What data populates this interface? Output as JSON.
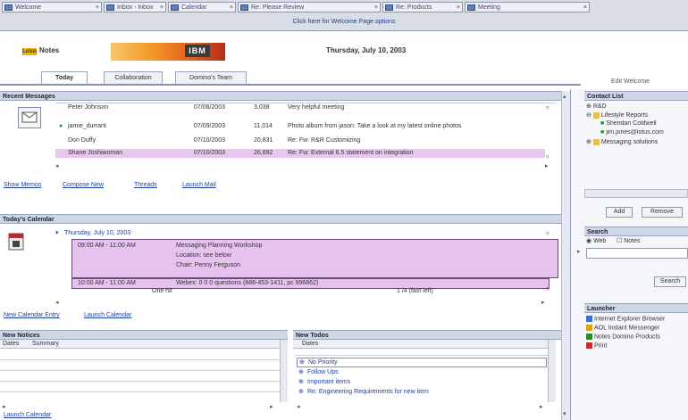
{
  "window_tabs": [
    {
      "label": "Welcome"
    },
    {
      "label": "Inbox - Inbox"
    },
    {
      "label": "Calendar"
    },
    {
      "label": "Re: Please Review"
    },
    {
      "label": "Re: Products"
    },
    {
      "label": "Meeting"
    }
  ],
  "welcome_bar": "Click here for Welcome Page options",
  "header": {
    "badge": "Lotus",
    "app_name": "Notes",
    "logo": "IBM",
    "date_title": "Thursday, July 10, 2003"
  },
  "nav_tabs": [
    "Today",
    "Collaboration",
    "Domino's Team"
  ],
  "edit_welcome": "Edit Welcome",
  "recent_messages": {
    "title": "Recent Messages",
    "rows": [
      {
        "from": "Peter Johnson",
        "date": "07/08/2003",
        "size": "3,038",
        "subject": "Very helpful meeting"
      },
      {
        "from": "jamie_durrant",
        "date": "07/09/2003",
        "size": "11,014",
        "subject": "Photo album from jason: Take a look at my latest online photos"
      },
      {
        "from": "Don Duffy",
        "date": "07/10/2003",
        "size": "20,831",
        "subject": "Re: Fw: R&R Customizing"
      },
      {
        "from": "Shane Joshiwoman",
        "date": "07/10/2003",
        "size": "26,892",
        "subject": "Re: Fw: External 6.5 statement on integration"
      }
    ],
    "links": [
      "Show Memos",
      "Compose New",
      "Threads",
      "Launch Mail"
    ]
  },
  "calendar": {
    "title": "Today's Calendar",
    "day_label": "Thursday, July 10, 2003",
    "entries": [
      {
        "time": "09:00 AM - 11:00 AM",
        "text": "Messaging Planning Workshop",
        "location": "Location: see below",
        "chair": "Chair: Penny Ferguson"
      },
      {
        "time": "10:00 AM - 11:00 AM",
        "text": "Webex: 0 0 0 questions (888-453-1411, pc 996862)"
      }
    ],
    "count_left": "One hit",
    "count_right": "1 /4 (fast left)",
    "links": [
      "New Calendar Entry",
      "Launch Calendar"
    ]
  },
  "new_notices": {
    "title": "New Notices",
    "columns": [
      "Dates",
      "Summary"
    ],
    "launch": "Launch Calendar"
  },
  "new_todos": {
    "title": "New Todos",
    "column": "Dates",
    "items": [
      "No Priority",
      "Follow Ups",
      "Important items",
      "Re: Engineering Requirements for new item"
    ]
  },
  "contact_list": {
    "title": "Contact List",
    "items": [
      "R&D",
      "Lifestyle Reports",
      "Sheridan Coldwell",
      "jim.jones@lotus.com",
      "Messaging solutions"
    ],
    "buttons": [
      "Add",
      "Remove"
    ]
  },
  "search": {
    "title": "Search",
    "options": [
      "Web",
      "Notes"
    ],
    "button": "Search"
  },
  "launcher": {
    "title": "Launcher",
    "items": [
      "Internet Explorer Browser",
      "AOL Instant Messenger",
      "Notes Domino Products",
      "Print"
    ]
  },
  "colors": {
    "title_bar": "#cfd7e6",
    "highlight": "#e8c6f0",
    "calendar_fill": "#e6c2ee",
    "accent": "#f39a2a"
  }
}
